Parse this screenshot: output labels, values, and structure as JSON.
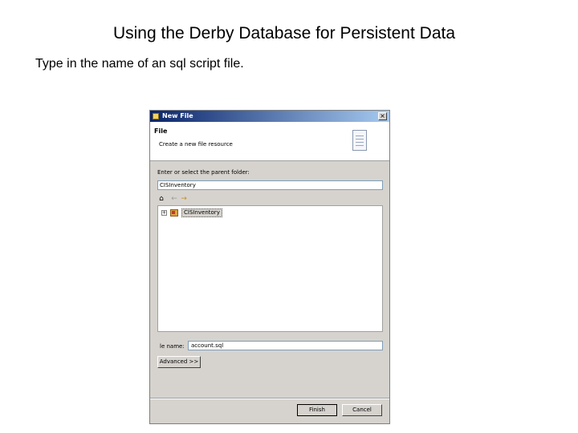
{
  "slide": {
    "title": "Using the Derby Database for Persistent Data",
    "caption": "Type in the name of an sql script file."
  },
  "dialog": {
    "window_title": "New File",
    "close_glyph": "×",
    "banner": {
      "heading": "File",
      "description": "Create a new file resource"
    },
    "parent_folder": {
      "label": "Enter or select the parent folder:",
      "value": "CISInventory"
    },
    "toolbar": {
      "home_glyph": "⌂",
      "back_glyph": "←",
      "forward_glyph": "→"
    },
    "tree": {
      "items": [
        {
          "expander": "+",
          "label": "CISInventory"
        }
      ]
    },
    "file_name": {
      "label": "le name:",
      "value": "account.sql"
    },
    "buttons": {
      "advanced": "Advanced >>",
      "finish": "Finish",
      "cancel": "Cancel"
    }
  }
}
